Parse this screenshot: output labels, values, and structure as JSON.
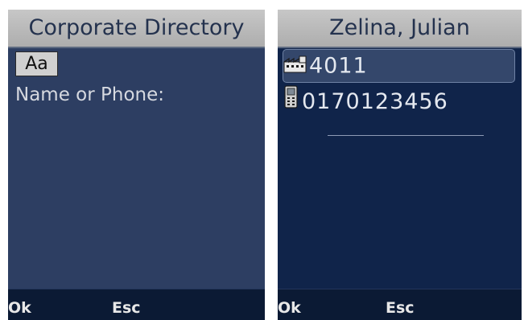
{
  "left_screen": {
    "title": "Corporate Directory",
    "input_mode": "Aa",
    "prompt": "Name or Phone:",
    "softkeys": {
      "ok": "Ok",
      "esc": "Esc"
    }
  },
  "right_screen": {
    "title": "Zelina, Julian",
    "entries": [
      {
        "icon": "office-phone-icon",
        "number": "4011",
        "selected": true
      },
      {
        "icon": "mobile-phone-icon",
        "number": "0170123456",
        "selected": false
      }
    ],
    "softkeys": {
      "ok": "Ok",
      "esc": "Esc"
    }
  },
  "colors": {
    "title_bar": "#bdbdbd",
    "left_body": "#2d3e62",
    "right_body": "#10244a",
    "softkey_bar": "#0b1a34",
    "selection": "#34476b"
  }
}
